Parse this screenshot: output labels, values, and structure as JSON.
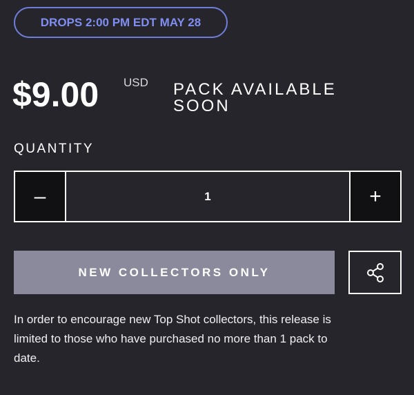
{
  "drop": {
    "label": "DROPS 2:00 PM EDT MAY 28"
  },
  "price": {
    "amount": "$9.00",
    "currency": "USD"
  },
  "status": {
    "text": "PACK AVAILABLE SOON"
  },
  "quantity": {
    "label": "QUANTITY",
    "minus_symbol": "–",
    "plus_symbol": "+",
    "value": "1"
  },
  "cta": {
    "label": "NEW COLLECTORS ONLY"
  },
  "share": {
    "icon": "share-icon"
  },
  "note": {
    "text": "In order to encourage new Top Shot collectors, this release is limited to those who have purchased no more than 1 pack to date."
  },
  "colors": {
    "background": "#26252b",
    "accent": "#7f8ef0",
    "cta_disabled": "#8a8a9c",
    "stepper_button": "#111114"
  }
}
